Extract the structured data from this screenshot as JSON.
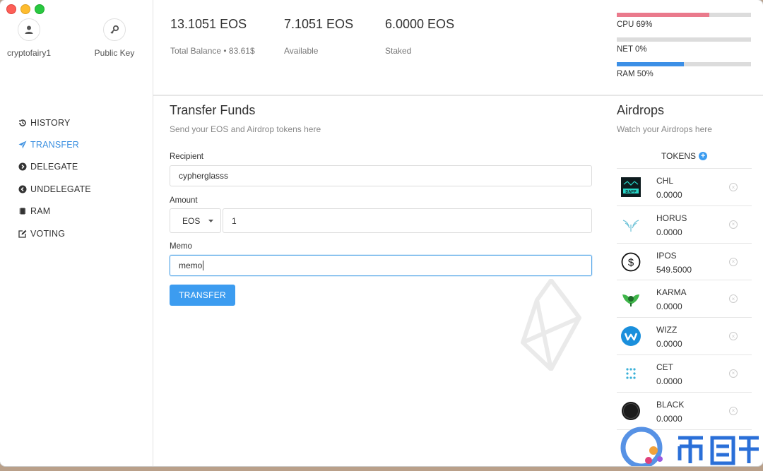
{
  "sidebar": {
    "account_name": "cryptofairy1",
    "public_key_label": "Public Key",
    "nav": [
      {
        "label": "HISTORY",
        "icon": "history-icon"
      },
      {
        "label": "TRANSFER",
        "icon": "send-icon",
        "active": true
      },
      {
        "label": "DELEGATE",
        "icon": "arrow-right-circle-icon"
      },
      {
        "label": "UNDELEGATE",
        "icon": "arrow-left-circle-icon"
      },
      {
        "label": "RAM",
        "icon": "chip-icon"
      },
      {
        "label": "VOTING",
        "icon": "edit-icon"
      }
    ]
  },
  "balances": {
    "total_value": "13.1051 EOS",
    "total_label": "Total Balance • 83.61$",
    "available_value": "7.1051 EOS",
    "available_label": "Available",
    "staked_value": "6.0000 EOS",
    "staked_label": "Staked"
  },
  "resources": [
    {
      "label": "CPU 69%",
      "percent": 69,
      "color": "#ea7a8c"
    },
    {
      "label": "NET 0%",
      "percent": 0,
      "color": "#3c9cf0"
    },
    {
      "label": "RAM 50%",
      "percent": 50,
      "color": "#3c8fe6"
    }
  ],
  "transfer": {
    "title": "Transfer Funds",
    "subtitle": "Send your EOS and Airdrop tokens here",
    "recipient_label": "Recipient",
    "recipient_value": "cypherglasss",
    "amount_label": "Amount",
    "currency": "EOS",
    "amount_value": "1",
    "memo_label": "Memo",
    "memo_value": "memo",
    "button_label": "TRANSFER"
  },
  "airdrops": {
    "title": "Airdrops",
    "subtitle": "Watch your Airdrops here",
    "tokens_label": "TOKENS",
    "tokens": [
      {
        "name": "CHL",
        "amount": "0.0000"
      },
      {
        "name": "HORUS",
        "amount": "0.0000"
      },
      {
        "name": "IPOS",
        "amount": "549.5000"
      },
      {
        "name": "KARMA",
        "amount": "0.0000"
      },
      {
        "name": "WIZZ",
        "amount": "0.0000"
      },
      {
        "name": "CET",
        "amount": "0.0000"
      },
      {
        "name": "BLACK",
        "amount": "0.0000"
      }
    ]
  }
}
